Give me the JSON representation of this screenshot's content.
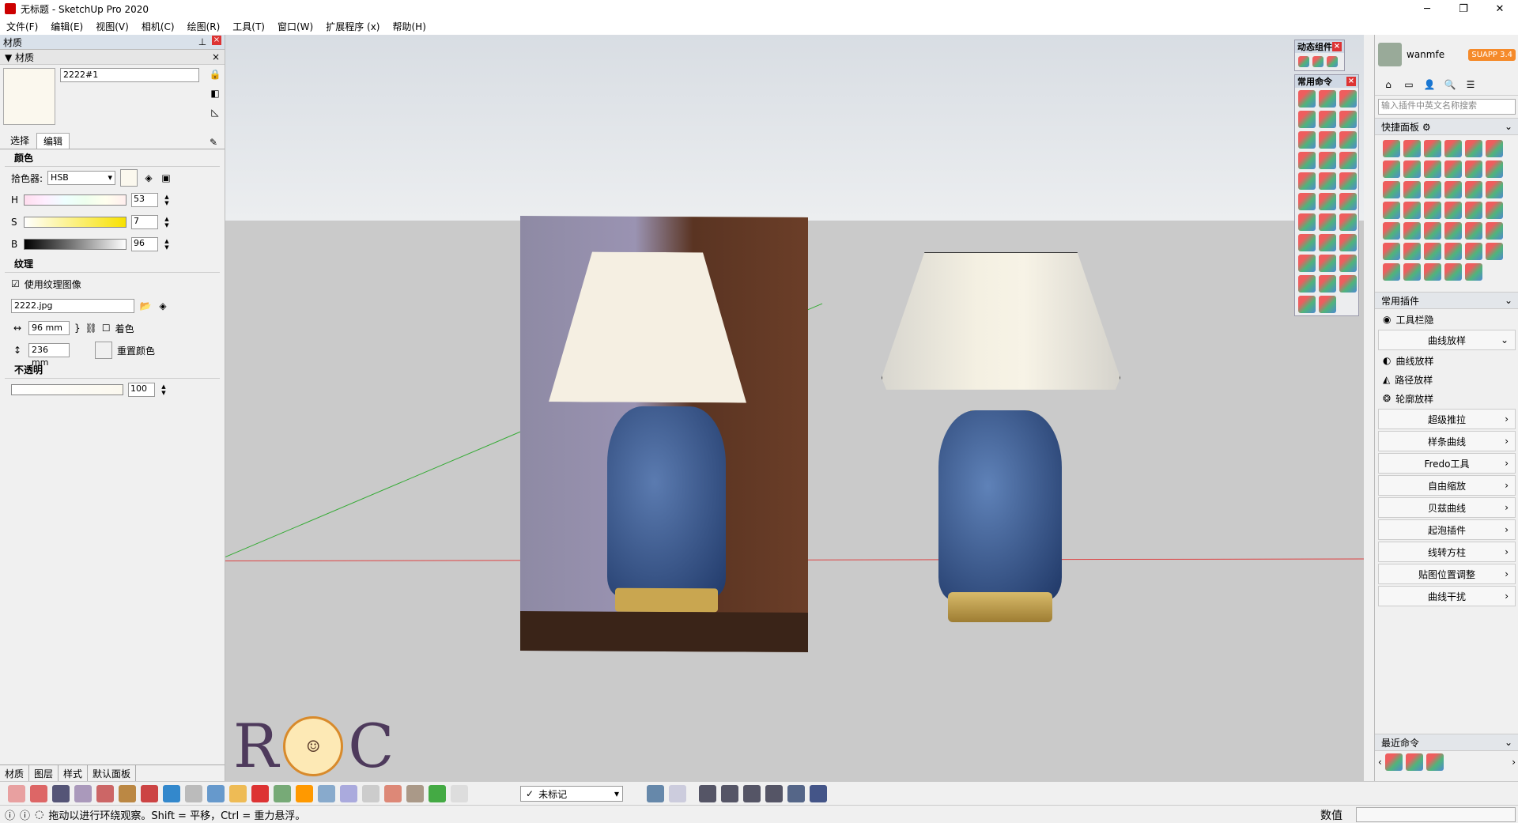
{
  "window": {
    "title": "无标题 - SketchUp Pro 2020",
    "controls": [
      "─",
      "❐",
      "✕"
    ]
  },
  "menu": [
    "文件(F)",
    "编辑(E)",
    "视图(V)",
    "相机(C)",
    "绘图(R)",
    "工具(T)",
    "窗口(W)",
    "扩展程序 (x)",
    "帮助(H)"
  ],
  "materials_panel": {
    "title": "材质",
    "sub_title": "材质",
    "material_name": "2222#1",
    "tabs": [
      "选择",
      "编辑"
    ],
    "active_tab": "编辑",
    "color_section": "颜色",
    "picker_label": "拾色器:",
    "picker_value": "HSB",
    "h_label": "H",
    "h_value": "53",
    "s_label": "S",
    "s_value": "7",
    "b_label": "B",
    "b_value": "96",
    "texture_section": "纹理",
    "use_texture_label": "使用纹理图像",
    "texture_file": "2222.jpg",
    "width_value": "96 mm",
    "height_value": "236 mm",
    "colorize_label": "着色",
    "reset_color_label": "重置颜色",
    "opacity_section": "不透明",
    "opacity_value": "100",
    "bottom_tabs": [
      "材质",
      "图层",
      "样式",
      "默认面板"
    ]
  },
  "floating": {
    "dynamic_components": "动态组件",
    "common_commands": "常用命令"
  },
  "watermark": {
    "left_letter": "R",
    "right_letter": "C"
  },
  "right_panel": {
    "username": "wanmfe",
    "badge": "SUAPP 3.4",
    "search_placeholder": "输入插件中英文名称搜索",
    "quick_panel": "快捷面板",
    "common_plugins": "常用插件",
    "plugins": [
      {
        "label": "工具栏隐",
        "type": "plain"
      },
      {
        "label": "曲线放样",
        "type": "group"
      },
      {
        "label": "曲线放样",
        "type": "plain"
      },
      {
        "label": "路径放样",
        "type": "plain"
      },
      {
        "label": "轮廓放样",
        "type": "plain"
      }
    ],
    "groups": [
      "超级推拉",
      "样条曲线",
      "Fredo工具",
      "自由缩放",
      "贝兹曲线",
      "起泡插件",
      "线转方柱",
      "贴图位置调整",
      "曲线干扰"
    ],
    "recent": "最近命令"
  },
  "bottom_toolbar": {
    "tag_value": "未标记"
  },
  "status": {
    "message": "拖动以进行环绕观察。Shift = 平移，Ctrl = 重力悬浮。",
    "value_label": "数值"
  },
  "colors": {
    "material_swatch": "#fbf8ee",
    "accent_orange": "#f58a2a",
    "close_red": "#d33333"
  }
}
